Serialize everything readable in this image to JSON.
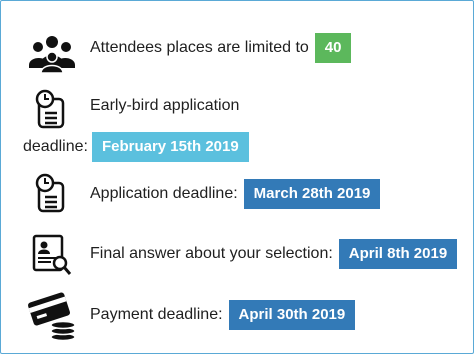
{
  "rows": {
    "attendees": {
      "label": "Attendees places are limited to",
      "value": "40",
      "icon": "group-icon"
    },
    "early_bird": {
      "label_line1": "Early-bird application",
      "label_line2": "deadline:",
      "value": "February 15th 2019",
      "icon": "clock-document-icon"
    },
    "application": {
      "label": "Application deadline:",
      "value": "March 28th 2019",
      "icon": "clock-document-icon"
    },
    "final_answer": {
      "label": "Final answer about your selection:",
      "value": "April 8th 2019",
      "icon": "profile-search-icon"
    },
    "payment": {
      "label": "Payment deadline:",
      "value": "April 30th 2019",
      "icon": "payment-card-coins-icon"
    }
  },
  "colors": {
    "green": "#5cb85c",
    "light_blue": "#5bc0de",
    "blue": "#337ab7",
    "border": "#5aa9d6"
  }
}
